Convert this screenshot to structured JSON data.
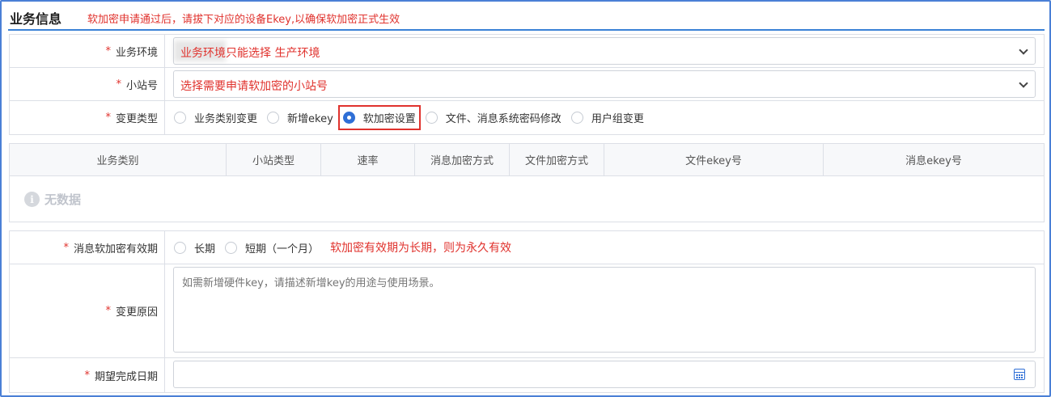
{
  "header": {
    "title": "业务信息",
    "note": "软加密申请通过后，请拔下对应的设备Ekey,以确保软加密正式生效"
  },
  "form": {
    "env": {
      "label": "业务环境",
      "value": "业务环境只能选择  生产环境"
    },
    "station": {
      "label": "小站号",
      "value": "选择需要申请软加密的小站号"
    },
    "change_type": {
      "label": "变更类型",
      "options": [
        "业务类别变更",
        "新增ekey",
        "软加密设置",
        "文件、消息系统密码修改",
        "用户组变更"
      ],
      "selected": "软加密设置"
    }
  },
  "table": {
    "columns": [
      "业务类别",
      "小站类型",
      "速率",
      "消息加密方式",
      "文件加密方式",
      "文件ekey号",
      "消息ekey号"
    ],
    "empty_text": "无数据"
  },
  "form2": {
    "validity": {
      "label": "消息软加密有效期",
      "options": [
        "长期",
        "短期（一个月）"
      ],
      "hint": "软加密有效期为长期，则为永久有效"
    },
    "reason": {
      "label": "变更原因",
      "placeholder": "如需新增硬件key，请描述新增key的用途与使用场景。"
    },
    "date": {
      "label": "期望完成日期",
      "value": ""
    }
  },
  "required_mark": "*",
  "icons": {
    "dropdown": "chevron-down-icon",
    "calendar": "calendar-icon",
    "empty": "info-icon"
  },
  "colors": {
    "accent": "#2f6fd6",
    "warning": "#e0322d"
  }
}
